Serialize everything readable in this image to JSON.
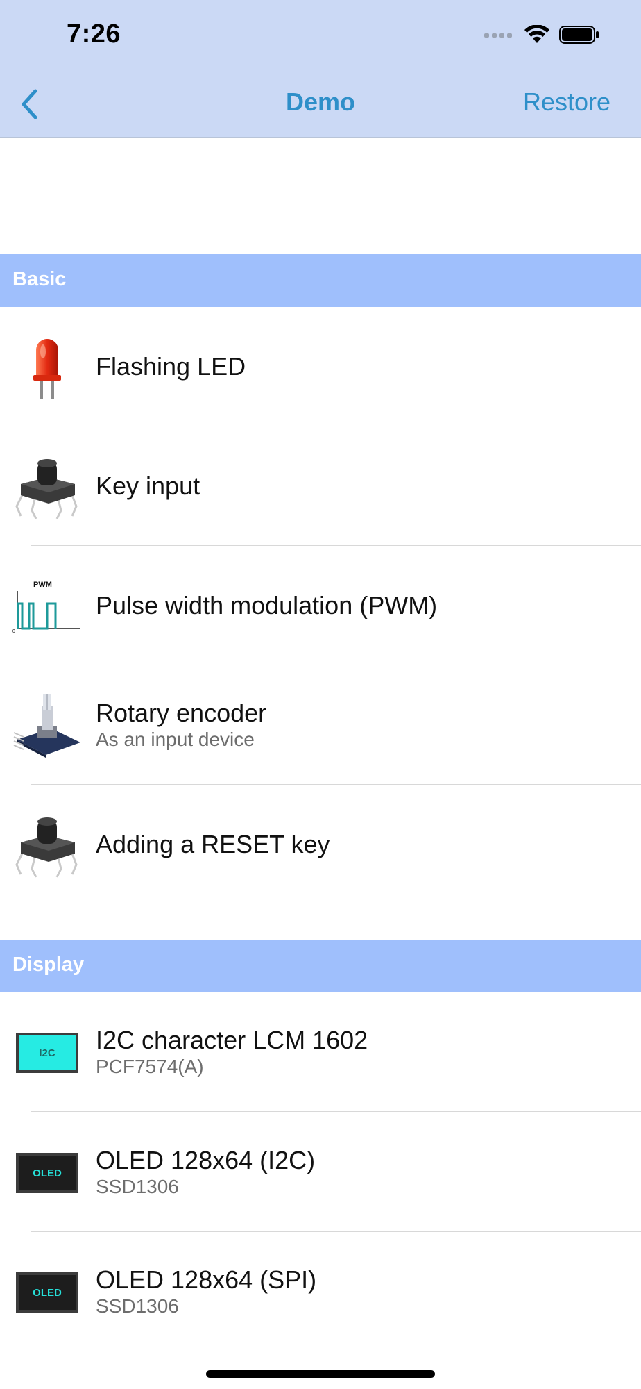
{
  "status_bar": {
    "time": "7:26"
  },
  "nav": {
    "back_icon": "chevron-left-icon",
    "title": "Demo",
    "restore_label": "Restore"
  },
  "colors": {
    "header_bg": "#cbd9f5",
    "accent": "#2e8fc9",
    "section_bg": "#9fbffc"
  },
  "sections": [
    {
      "title": "Basic",
      "items": [
        {
          "title": "Flashing LED",
          "subtitle": "",
          "icon": "red-led-icon"
        },
        {
          "title": "Key input",
          "subtitle": "",
          "icon": "push-button-icon"
        },
        {
          "title": "Pulse width modulation (PWM)",
          "subtitle": "",
          "icon": "pwm-wave-icon",
          "icon_text": "PWM"
        },
        {
          "title": "Rotary encoder",
          "subtitle": "As an input device",
          "icon": "rotary-encoder-icon"
        },
        {
          "title": "Adding a RESET key",
          "subtitle": "",
          "icon": "push-button-icon"
        }
      ]
    },
    {
      "title": "Display",
      "items": [
        {
          "title": "I2C character LCM 1602",
          "subtitle": "PCF7574(A)",
          "icon": "i2c-chip-icon",
          "icon_text": "I2C"
        },
        {
          "title": "OLED 128x64 (I2C)",
          "subtitle": "SSD1306",
          "icon": "oled-chip-icon",
          "icon_text": "OLED"
        },
        {
          "title": "OLED 128x64 (SPI)",
          "subtitle": "SSD1306",
          "icon": "oled-chip-icon",
          "icon_text": "OLED"
        }
      ]
    }
  ]
}
